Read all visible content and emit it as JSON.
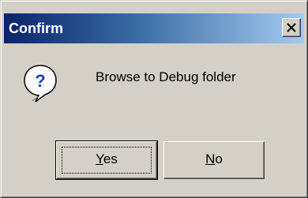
{
  "dialog": {
    "title": "Confirm",
    "message": "Browse to Debug folder",
    "icon": "question-icon"
  },
  "buttons": {
    "yes": {
      "mnemonic": "Y",
      "rest": "es"
    },
    "no": {
      "mnemonic": "N",
      "rest": "o"
    }
  },
  "colors": {
    "titlebar_start": "#0a246a",
    "titlebar_end": "#a6caf0",
    "face": "#d4d0c8",
    "icon_blue": "#1f3fbf"
  }
}
